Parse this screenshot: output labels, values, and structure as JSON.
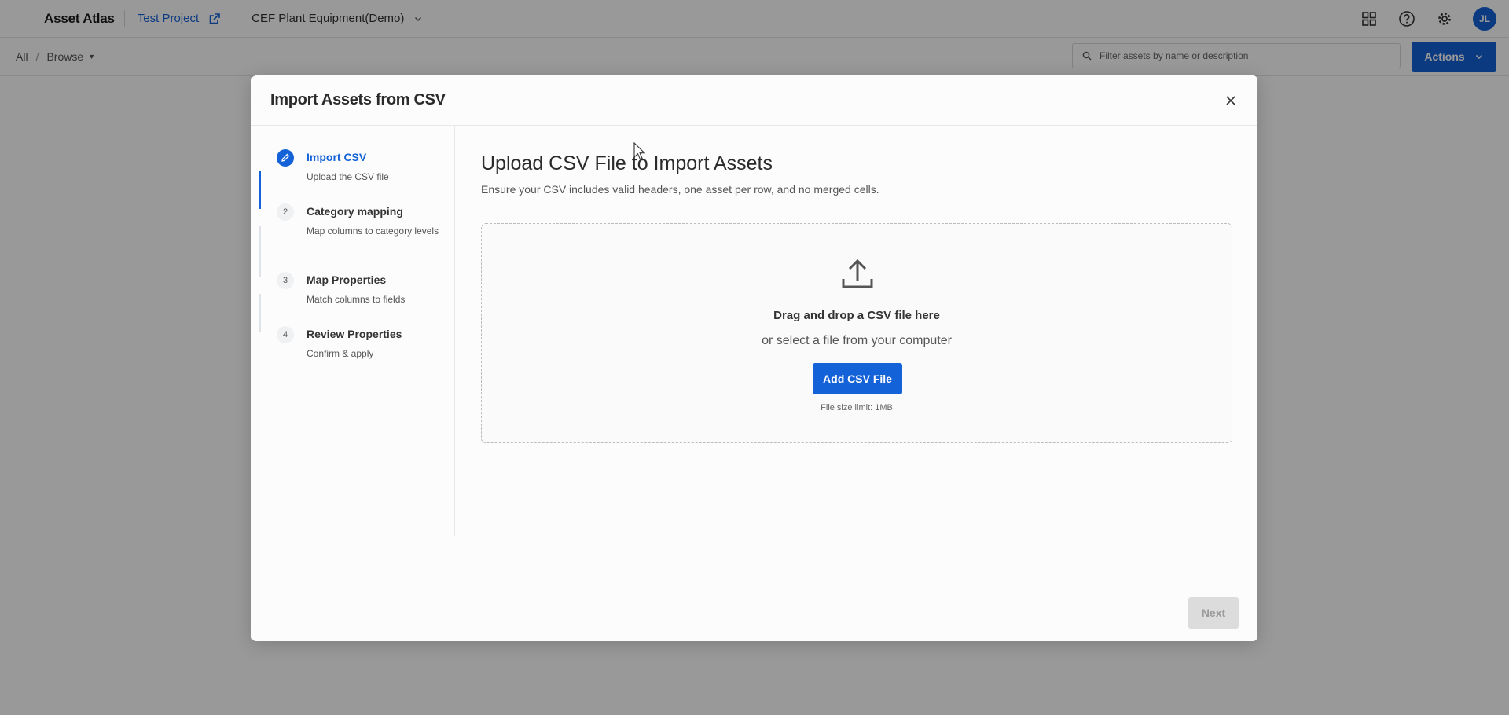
{
  "app": {
    "brand": "Asset Atlas",
    "project": "Test Project",
    "dataset": "CEF Plant Equipment(Demo)",
    "avatar_initials": "JL",
    "accent_color": "#1462d8"
  },
  "toolbar": {
    "breadcrumb_all": "All",
    "breadcrumb_browse": "Browse",
    "filter_placeholder": "Filter assets by name or description",
    "actions_label": "Actions"
  },
  "icons": {
    "project_link": "external-link-icon",
    "dataset_dropdown": "chevron-down-icon",
    "apps": "grid-icon",
    "help": "help-circle-icon",
    "settings": "gear-icon",
    "search": "search-icon",
    "close": "close-icon",
    "step_active": "pencil-icon",
    "upload": "upload-icon"
  },
  "modal": {
    "title": "Import Assets from CSV",
    "steps": [
      {
        "number": "",
        "title": "Import CSV",
        "description": "Upload the CSV file",
        "state": "active"
      },
      {
        "number": "2",
        "title": "Category mapping",
        "description": "Map columns to category levels",
        "state": "pending"
      },
      {
        "number": "3",
        "title": "Map Properties",
        "description": "Match columns to fields",
        "state": "pending"
      },
      {
        "number": "4",
        "title": "Review Properties",
        "description": "Confirm & apply",
        "state": "pending"
      }
    ],
    "content_title": "Upload CSV File to Import Assets",
    "content_subtitle": "Ensure your CSV includes valid headers, one asset per row, and no merged cells.",
    "dropzone": {
      "title": "Drag and drop a CSV file here",
      "subtitle": "or select a file from your computer",
      "button_label": "Add CSV File",
      "size_limit": "File size limit: 1MB"
    },
    "next_label": "Next"
  }
}
